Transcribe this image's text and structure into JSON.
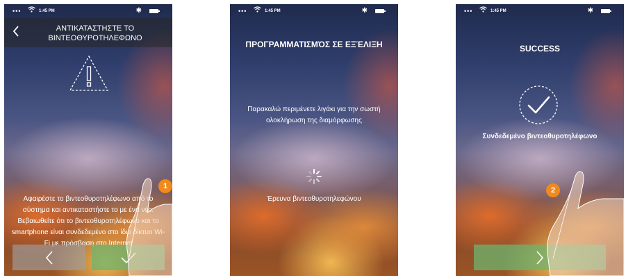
{
  "status_bar": {
    "time": "1:45 PM"
  },
  "screen1": {
    "header_title": "ΑΝΤΙΚΑΤΑΣΤΗΣΤΕ ΤΟ ΒΙΝΤΕΟΘΥΡΟΤΗΛΕΦΩΝΟ",
    "instructions": "Αφαιρέστε το βιντεοθυροτηλέφωνο από το σύστημα και αντικαταστήστε το με ένα νέο. Βεβαιωθείτε ότι το βιντεοθυροτηλέφωνο και το smartphone είναι συνδεδεμένο στο ίδιο δίκτυο Wi-Fi με πρόσβαση στο Internet",
    "marker": "1"
  },
  "screen2": {
    "title": "ΠΡΟΓΡΑΜΜΑΤΙΣΜΌΣ ΣΕ ΕΞΈΛΙΞΗ",
    "message": "Παρακαλώ περιμένετε λιγάκι για την σωστή ολοκλήρωση της διαμόρφωσης",
    "searching": "Έρευνα βιντεοθυροτηλεφώνου"
  },
  "screen3": {
    "title": "SUCCESS",
    "connected": "Συνδεδεμένο βιντεοθυροτηλέφωνο",
    "marker": "2"
  },
  "colors": {
    "accent_marker": "#f08a1c",
    "confirm_button": "#6eb46e",
    "prev_button": "#a0a0a0"
  }
}
